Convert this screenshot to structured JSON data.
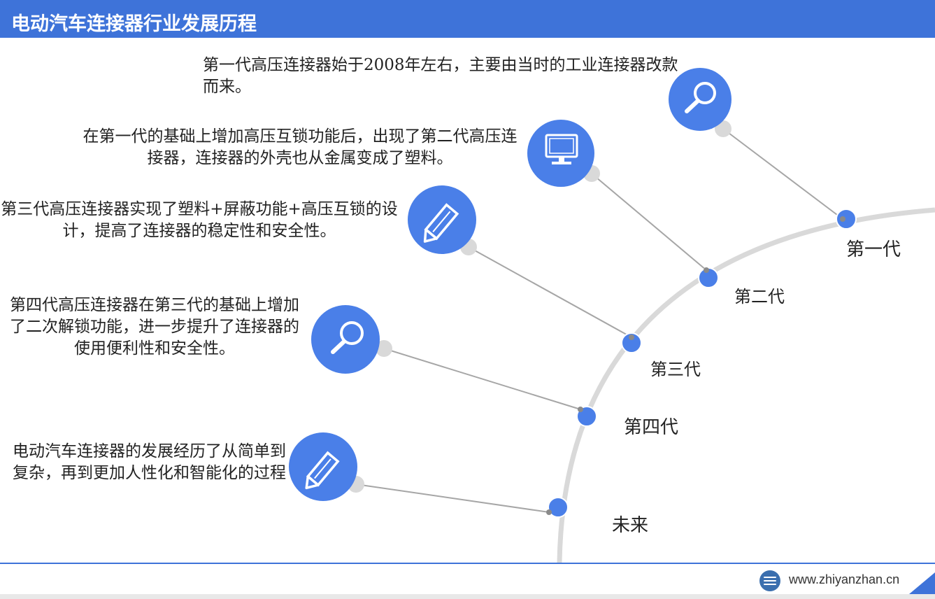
{
  "header": {
    "title": "电动汽车连接器行业发展历程"
  },
  "colors": {
    "accent": "#3e73d9",
    "node": "#4a7fe8",
    "arc": "#d9d9d9",
    "connector": "#a6a6a6"
  },
  "stages": [
    {
      "generation": "第一代",
      "icon": "magnifier-icon",
      "text": "第一代高压连接器始于2008年左右，主要由当时的工业连接器改款而来。"
    },
    {
      "generation": "第二代",
      "icon": "monitor-icon",
      "text": "在第一代的基础上增加高压互锁功能后，出现了第二代高压连接器，连接器的外壳也从金属变成了塑料。"
    },
    {
      "generation": "第三代",
      "icon": "pencil-icon",
      "text": "第三代高压连接器实现了塑料+屏蔽功能+高压互锁的设计，提高了连接器的稳定性和安全性。"
    },
    {
      "generation": "第四代",
      "icon": "magnifier-icon",
      "text": "第四代高压连接器在第三代的基础上增加了二次解锁功能，进一步提升了连接器的使用便利性和安全性。"
    },
    {
      "generation": "未来",
      "icon": "pencil-icon",
      "text": "电动汽车连接器的发展经历了从简单到复杂，再到更加人性化和智能化的过程"
    }
  ],
  "footer": {
    "url": "www.zhiyanzhan.cn",
    "logo": "zhiyan-logo-icon"
  }
}
